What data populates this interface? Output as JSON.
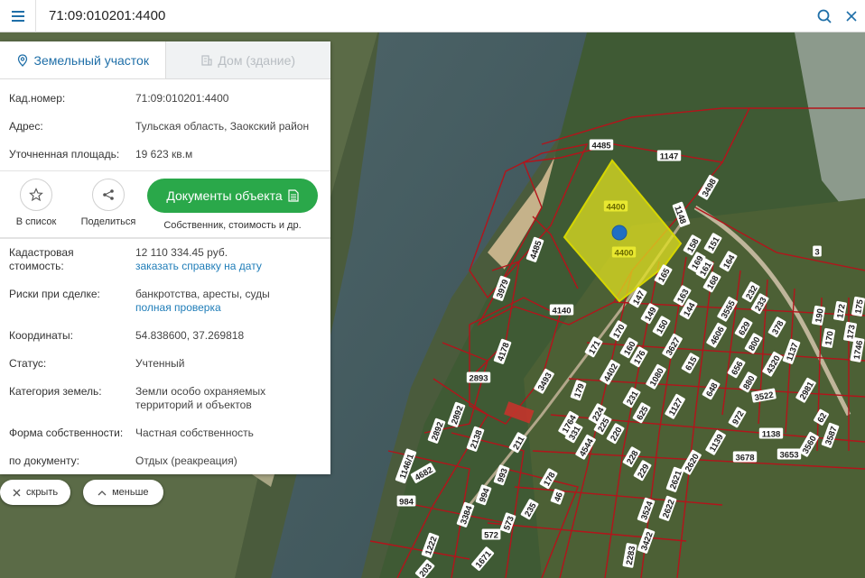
{
  "search": {
    "value": "71:09:010201:4400"
  },
  "tabs": [
    {
      "label": "Земельный участок",
      "active": true
    },
    {
      "label": "Дом (здание)",
      "active": false
    }
  ],
  "info": {
    "cad_number_label": "Кад.номер:",
    "cad_number_value": "71:09:010201:4400",
    "address_label": "Адрес:",
    "address_value": "Тульская область, Заокский район",
    "area_label": "Уточненная площадь:",
    "area_value": "19 623 кв.м",
    "cost_label_1": "Кадастровая",
    "cost_label_2": "стоимость:",
    "cost_value": "12 110 334.45 руб.",
    "cost_link": "заказать справку на дату",
    "risks_label": "Риски при сделке:",
    "risks_value": "банкротства, аресты, суды",
    "risks_link": "полная проверка",
    "coords_label": "Координаты:",
    "coords_value": "54.838600, 37.269818",
    "status_label": "Статус:",
    "status_value": "Учтенный",
    "category_label": "Категория земель:",
    "category_value_1": "Земли особо охраняемых",
    "category_value_2": "территорий и объектов",
    "ownership_label": "Форма собственности:",
    "ownership_value": "Частная собственность",
    "doc_label": "по документу:",
    "doc_value": "Отдых (реакреация)"
  },
  "actions": {
    "add_to_list": "В список",
    "share": "Поделиться",
    "documents_button": "Документы объекта",
    "documents_caption": "Собственник, стоимость и др."
  },
  "bottom": {
    "hide": "скрыть",
    "less": "меньше"
  },
  "colors": {
    "accent": "#1f6fa8",
    "green": "#2aa84a",
    "parcel": "#e0e020",
    "boundary": "#b3141b"
  },
  "map_labels": {
    "top": [
      "4485",
      "1147",
      "3498",
      "4400",
      "4400",
      "1148",
      "3",
      "4485",
      "3979",
      "4140",
      "158",
      "151",
      "169",
      "161",
      "164",
      "165",
      "163",
      "168",
      "232",
      "147",
      "149",
      "144",
      "3555",
      "233",
      "150",
      "629",
      "378",
      "170",
      "160",
      "3627",
      "4606",
      "800",
      "4178",
      "171",
      "4402",
      "176",
      "615",
      "656",
      "4320",
      "1137",
      "1080",
      "2893",
      "3493",
      "179",
      "231",
      "648",
      "880",
      "3522",
      "2981",
      "625",
      "1127",
      "972",
      "62",
      "1764",
      "224",
      "331",
      "225",
      "220",
      "1139",
      "1138",
      "3587",
      "3560",
      "2892",
      "2892",
      "2138",
      "211",
      "4544",
      "228",
      "229",
      "2620",
      "3678",
      "3653",
      "1146/1",
      "4682",
      "993",
      "178",
      "2621",
      "994",
      "46",
      "984",
      "3384",
      "235",
      "573",
      "3524",
      "2622",
      "572",
      "1222",
      "203",
      "1671",
      "3422",
      "2283",
      "190",
      "170",
      "172",
      "173",
      "1746",
      "175"
    ]
  }
}
